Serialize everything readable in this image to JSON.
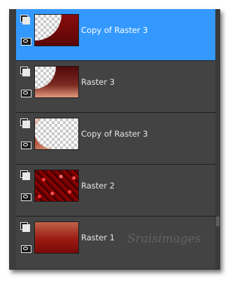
{
  "layers": [
    {
      "name": "Copy of Raster 3",
      "selected": true
    },
    {
      "name": "Raster 3",
      "selected": false
    },
    {
      "name": "Copy of Raster 3",
      "selected": false
    },
    {
      "name": "Raster 2",
      "selected": false
    },
    {
      "name": "Raster 1",
      "selected": false
    }
  ],
  "watermark": "Sraisimages",
  "colors": {
    "selected": "#3399ff",
    "panel": "#3d3d3d",
    "dark_red": "#8c0f0f"
  },
  "icons": {
    "visibility": "layer-stack-icon",
    "eye": "eye-icon"
  }
}
